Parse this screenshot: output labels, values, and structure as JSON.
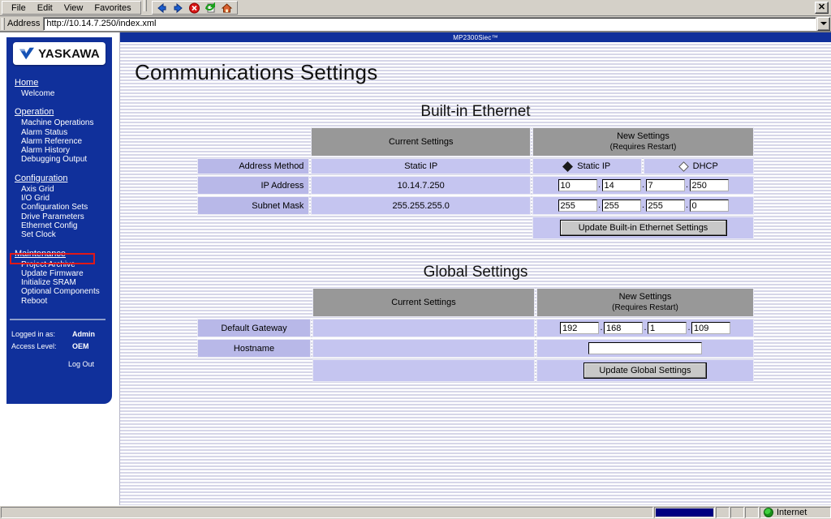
{
  "browser": {
    "menu": [
      "File",
      "Edit",
      "View",
      "Favorites"
    ],
    "toolbar_icons": [
      "back-icon",
      "forward-icon",
      "stop-icon",
      "refresh-icon",
      "home-icon"
    ],
    "close_label": "✕",
    "address_label": "Address",
    "address_value": "http://10.14.7.250/index.xml"
  },
  "sidebar": {
    "logo_text": "YASKAWA",
    "groups": [
      {
        "heading": "Home",
        "items": [
          "Welcome"
        ]
      },
      {
        "heading": "Operation",
        "items": [
          "Machine Operations",
          "Alarm Status",
          "Alarm Reference",
          "Alarm History",
          "Debugging Output"
        ]
      },
      {
        "heading": "Configuration",
        "items": [
          "Axis Grid",
          "I/O Grid",
          "Configuration Sets",
          "Drive Parameters",
          "Ethernet Config",
          "Set Clock"
        ]
      },
      {
        "heading": "Maintenance",
        "items": [
          "Project Archive",
          "Update Firmware",
          "Initialize SRAM",
          "Optional Components",
          "Reboot"
        ]
      }
    ],
    "login": {
      "logged_in_label": "Logged in as:",
      "logged_in_value": "Admin",
      "access_level_label": "Access Level:",
      "access_level_value": "OEM",
      "logout_label": "Log Out"
    },
    "highlight_color": "#e01818",
    "highlighted_item": "Ethernet Config"
  },
  "content": {
    "window_title": "MP2300Siec™",
    "page_title": "Communications Settings",
    "builtin": {
      "section_title": "Built-in Ethernet",
      "col_current": "Current Settings",
      "col_new": "New Settings",
      "col_new_sub": "(Requires Restart)",
      "rows": {
        "address_method": {
          "label": "Address Method",
          "current": "Static IP",
          "option_static": "Static IP",
          "option_dhcp": "DHCP",
          "selected": "Static IP"
        },
        "ip_address": {
          "label": "IP Address",
          "current": "10.14.7.250",
          "octets": [
            "10",
            "14",
            "7",
            "250"
          ]
        },
        "subnet_mask": {
          "label": "Subnet Mask",
          "current": "255.255.255.0",
          "octets": [
            "255",
            "255",
            "255",
            "0"
          ]
        }
      },
      "update_button": "Update Built-in Ethernet Settings"
    },
    "global": {
      "section_title": "Global Settings",
      "col_current": "Current Settings",
      "col_new": "New Settings",
      "col_new_sub": "(Requires Restart)",
      "rows": {
        "default_gateway": {
          "label": "Default Gateway",
          "current": "",
          "octets": [
            "192",
            "168",
            "1",
            "109"
          ]
        },
        "hostname": {
          "label": "Hostname",
          "current": "",
          "value": ""
        }
      },
      "update_button": "Update Global Settings"
    }
  },
  "statusbar": {
    "message": "",
    "zone": "Internet"
  }
}
